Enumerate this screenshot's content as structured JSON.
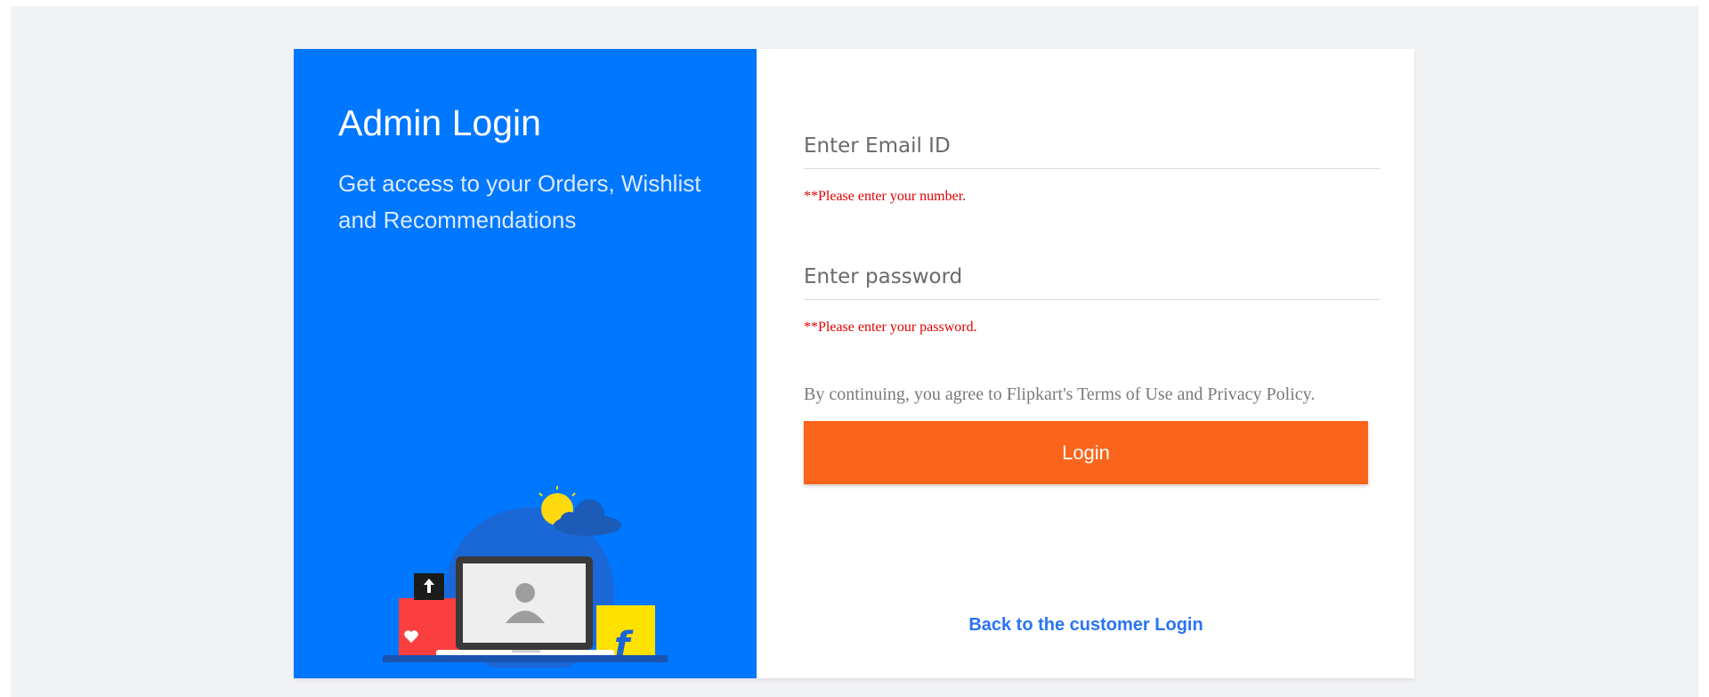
{
  "left": {
    "title": "Admin Login",
    "subtitle": "Get access to your Orders, Wishlist and Recommendations"
  },
  "form": {
    "email": {
      "placeholder": "Enter Email ID",
      "value": "",
      "error": "**Please enter your number."
    },
    "password": {
      "placeholder": "Enter password",
      "value": "",
      "error": "**Please enter your password."
    },
    "terms_text": "By continuing, you agree to Flipkart's Terms of Use and Privacy Policy.",
    "login_label": "Login",
    "back_link_label": "Back to the customer Login"
  },
  "colors": {
    "left_panel": "#0077ff",
    "login_button": "#fb641b",
    "error_text": "#e00000",
    "link": "#2874f0"
  },
  "icons": [
    "sun-icon",
    "cloud-icon",
    "laptop-icon",
    "user-icon",
    "heart-icon",
    "upload-icon",
    "flipkart-f-icon"
  ]
}
